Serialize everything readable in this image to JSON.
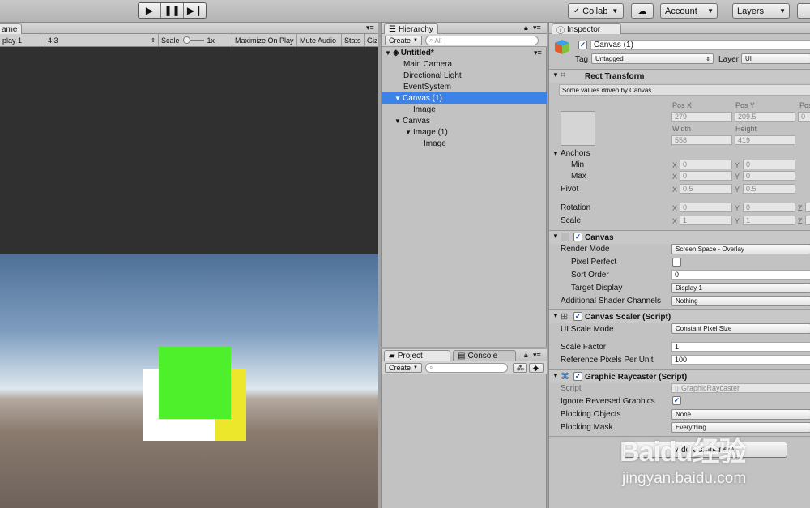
{
  "toolbar": {
    "collab": "Collab",
    "account": "Account",
    "layers": "Layers"
  },
  "game": {
    "tab": "ame",
    "display": "play 1",
    "aspect": "4:3",
    "scale_label": "Scale",
    "scale_value": "1x",
    "maximize": "Maximize On Play",
    "mute": "Mute Audio",
    "stats": "Stats",
    "gizmos": "Giz"
  },
  "hierarchy": {
    "tab": "Hierarchy",
    "create": "Create",
    "search_placeholder": "All",
    "rows": [
      {
        "label": "Untitled*",
        "arrow": "▼",
        "bold": true
      },
      {
        "label": "Main Camera",
        "arrow": ""
      },
      {
        "label": "Directional Light",
        "arrow": ""
      },
      {
        "label": "EventSystem",
        "arrow": ""
      },
      {
        "label": "Canvas (1)",
        "arrow": "▼",
        "selected": true
      },
      {
        "label": "Image",
        "arrow": ""
      },
      {
        "label": "Canvas",
        "arrow": "▼"
      },
      {
        "label": "Image (1)",
        "arrow": "▼"
      },
      {
        "label": "Image",
        "arrow": ""
      }
    ]
  },
  "project": {
    "tab_project": "Project",
    "tab_console": "Console",
    "create": "Create"
  },
  "inspector": {
    "tab": "Inspector",
    "object_name": "Canvas (1)",
    "tag_label": "Tag",
    "tag_value": "Untagged",
    "layer_label": "Layer",
    "layer_value": "UI",
    "rect": {
      "title": "Rect Transform",
      "note": "Some values driven by Canvas.",
      "posx_label": "Pos X",
      "posx": "279",
      "posy_label": "Pos Y",
      "posy": "209.5",
      "posz_label": "Pos",
      "posz": "0",
      "width_label": "Width",
      "width": "558",
      "height_label": "Height",
      "height": "419",
      "anchors": "Anchors",
      "min": "Min",
      "max": "Max",
      "pivot": "Pivot",
      "min_x": "0",
      "min_y": "0",
      "max_x": "0",
      "max_y": "0",
      "pivot_x": "0.5",
      "pivot_y": "0.5",
      "rotation": "Rotation",
      "scale": "Scale",
      "rot_x": "0",
      "rot_y": "0",
      "scale_x": "1",
      "scale_y": "1",
      "x": "X",
      "y": "Y",
      "z": "Z"
    },
    "canvas": {
      "title": "Canvas",
      "render_mode_label": "Render Mode",
      "render_mode": "Screen Space - Overlay",
      "pixel_perfect": "Pixel Perfect",
      "sort_order_label": "Sort Order",
      "sort_order": "0",
      "target_display_label": "Target Display",
      "target_display": "Display 1",
      "shader_label": "Additional Shader Channels",
      "shader": "Nothing"
    },
    "scaler": {
      "title": "Canvas Scaler (Script)",
      "mode_label": "UI Scale Mode",
      "mode": "Constant Pixel Size",
      "factor_label": "Scale Factor",
      "factor": "1",
      "ppu_label": "Reference Pixels Per Unit",
      "ppu": "100"
    },
    "raycaster": {
      "title": "Graphic Raycaster (Script)",
      "script_label": "Script",
      "script": "GraphicRaycaster",
      "ignore_label": "Ignore Reversed Graphics",
      "blocking_label": "Blocking Objects",
      "blocking": "None",
      "mask_label": "Blocking Mask",
      "mask": "Everything"
    },
    "add_component": "Add Component"
  },
  "watermark": {
    "logo": "Baidu经验",
    "url": "jingyan.baidu.com"
  },
  "colors": {
    "selection": "#3d82e6",
    "green_image": "#4ef02b",
    "yellow_image": "#ece72a",
    "white_image": "#ffffff"
  }
}
